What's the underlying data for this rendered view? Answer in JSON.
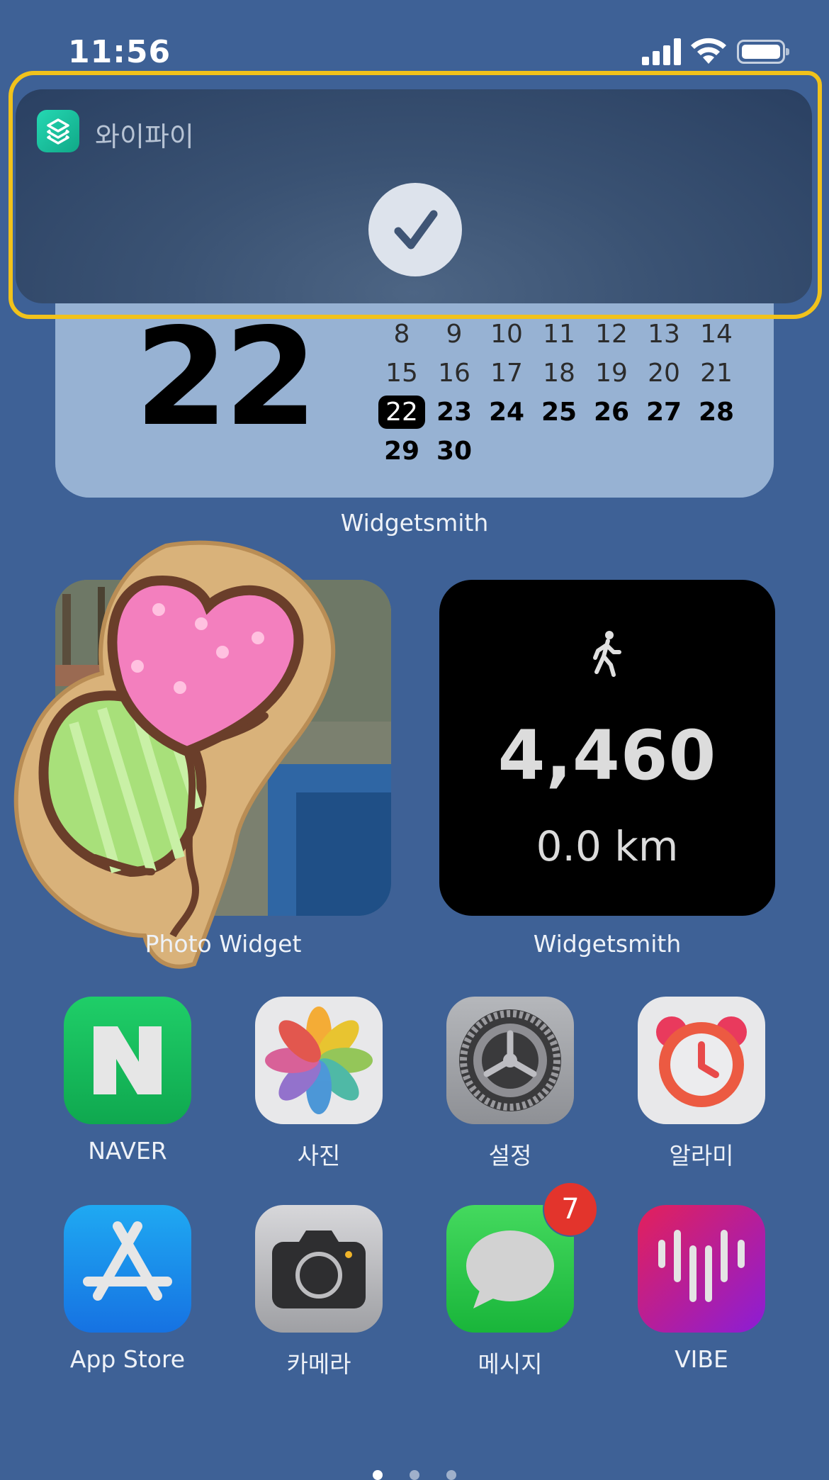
{
  "status_bar": {
    "time": "11:56"
  },
  "notification": {
    "app_name": "와이파이"
  },
  "calendar_widget": {
    "big_day": "22",
    "rows": [
      [
        "8",
        "9",
        "10",
        "11",
        "12",
        "13",
        "14"
      ],
      [
        "15",
        "16",
        "17",
        "18",
        "19",
        "20",
        "21"
      ],
      [
        "22",
        "23",
        "24",
        "25",
        "26",
        "27",
        "28"
      ],
      [
        "29",
        "30"
      ]
    ],
    "today": "22",
    "label": "Widgetsmith"
  },
  "photo_widget": {
    "label": "Photo Widget"
  },
  "steps_widget": {
    "steps": "4,460",
    "distance": "0.0 km",
    "label": "Widgetsmith"
  },
  "apps_row1": [
    {
      "label": "NAVER",
      "icon": "naver-icon"
    },
    {
      "label": "사진",
      "icon": "photos-icon"
    },
    {
      "label": "설정",
      "icon": "settings-icon"
    },
    {
      "label": "알라미",
      "icon": "alarmy-icon"
    }
  ],
  "apps_row2": [
    {
      "label": "App Store",
      "icon": "app-store-icon"
    },
    {
      "label": "카메라",
      "icon": "camera-icon"
    },
    {
      "label": "메시지",
      "icon": "messages-icon",
      "badge": "7"
    },
    {
      "label": "VIBE",
      "icon": "vibe-icon"
    }
  ],
  "colors": {
    "wallpaper": "#3e6196",
    "highlight": "#f1c21b",
    "badge": "#e3342c"
  }
}
